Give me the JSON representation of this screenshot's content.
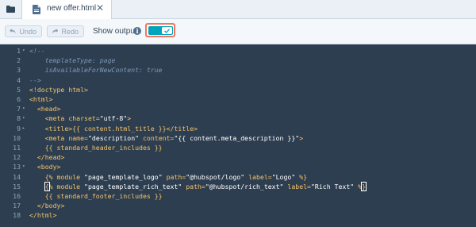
{
  "tab": {
    "title": "new offer.html",
    "close_icon": "close-icon"
  },
  "toolbar": {
    "undo_label": "Undo",
    "redo_label": "Redo",
    "show_output_label": "Show output",
    "info_icon": "i"
  },
  "colors": {
    "accent": "#00a4bd",
    "highlight": "#f2745f",
    "editor_bg": "#2d3e50"
  },
  "code_lines": [
    "<!--",
    "    templateType: page",
    "    isAvailableForNewContent: true",
    "-->",
    "<!doctype html>",
    "<html>",
    "  <head>",
    "    <meta charset=\"utf-8\">",
    "    <title>{{ content.html_title }}</title>",
    "    <meta name=\"description\" content=\"{{ content.meta_description }}\">",
    "    {{ standard_header_includes }}",
    "  </head>",
    "  <body>",
    "    {% module \"page_template_logo\" path=\"@hubspot/logo\" label=\"Logo\" %}",
    "    {% module \"page_template_rich_text\" path=\"@hubspot/rich_text\" label=\"Rich Text\" %}",
    "    {{ standard_footer_includes }}",
    "  </body>",
    "</html>"
  ],
  "line_numbers": [
    "1",
    "2",
    "3",
    "4",
    "5",
    "6",
    "7",
    "8",
    "9",
    "10",
    "11",
    "12",
    "13",
    "14",
    "15",
    "16",
    "17",
    "18"
  ],
  "folds": [
    "▾",
    "",
    "",
    "",
    "",
    "",
    "▾",
    "▾",
    "▸",
    "",
    "",
    "",
    "▾",
    "",
    "",
    "",
    "",
    ""
  ]
}
